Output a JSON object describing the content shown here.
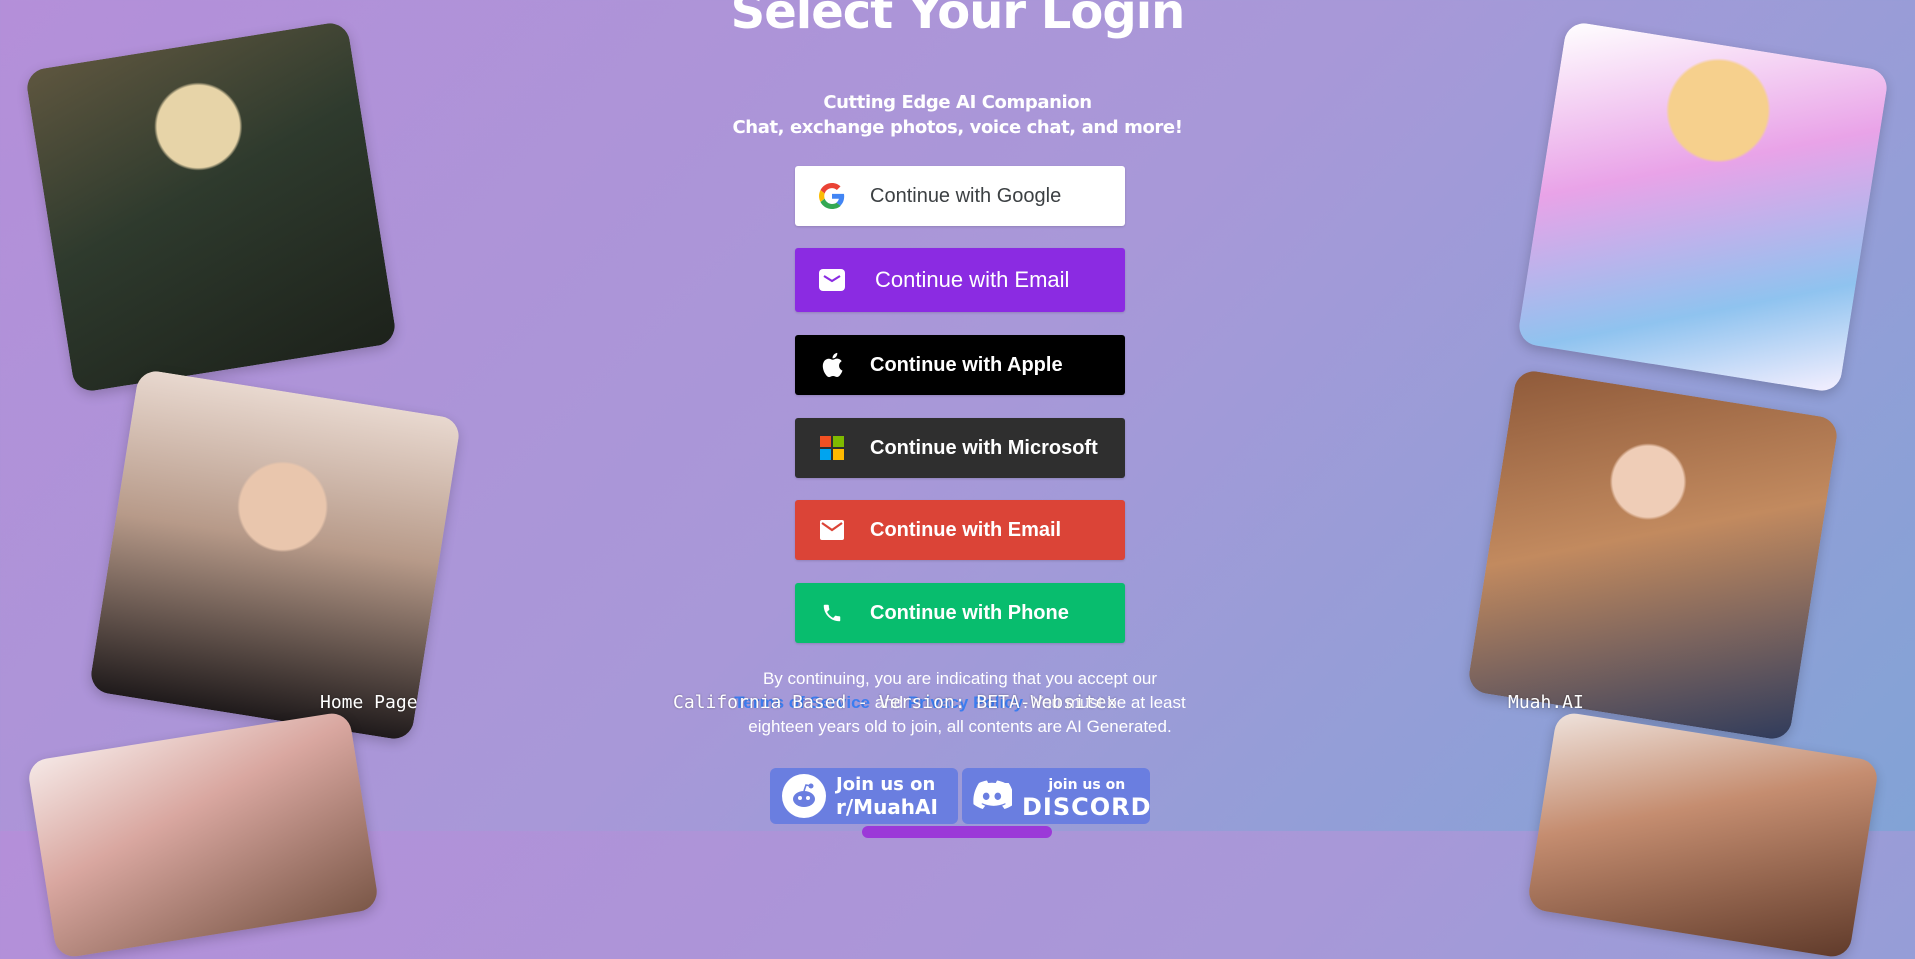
{
  "page": {
    "title": "Select Your Login",
    "subtitle_line1": "Cutting Edge AI Companion",
    "subtitle_line2": "Chat, exchange photos, voice chat, and more!"
  },
  "buttons": {
    "google": "Continue with Google",
    "email_primary": "Continue with Email",
    "apple": "Continue with Apple",
    "microsoft": "Continue with Microsoft",
    "email_secondary": "Continue with Email",
    "phone": "Continue with Phone"
  },
  "consent": {
    "line1": "By continuing, you are indicating that you accept our",
    "terms": "Terms of Service",
    "and": " and ",
    "privacy": "Privacy Policy",
    "after": ". You must be at least",
    "line3": "eighteen years old to join, all contents are AI Generated."
  },
  "overlay": {
    "left": "Home Page",
    "center": "California Based - Version: BETA-Websitex",
    "right": "Muah.AI"
  },
  "community": {
    "reddit_line1": "Join us on",
    "reddit_line2": "r/MuahAI",
    "discord_line1": "join us on",
    "discord_line2": "DISCORD"
  },
  "colors": {
    "email_primary": "#8b2be2",
    "apple": "#000000",
    "microsoft": "#2f2f2f",
    "email_secondary": "#db4437",
    "phone": "#08bd6e",
    "link": "#3c7df0"
  },
  "icons": [
    "google-icon",
    "mail-icon",
    "apple-icon",
    "microsoft-icon",
    "phone-icon",
    "reddit-icon",
    "discord-icon"
  ]
}
